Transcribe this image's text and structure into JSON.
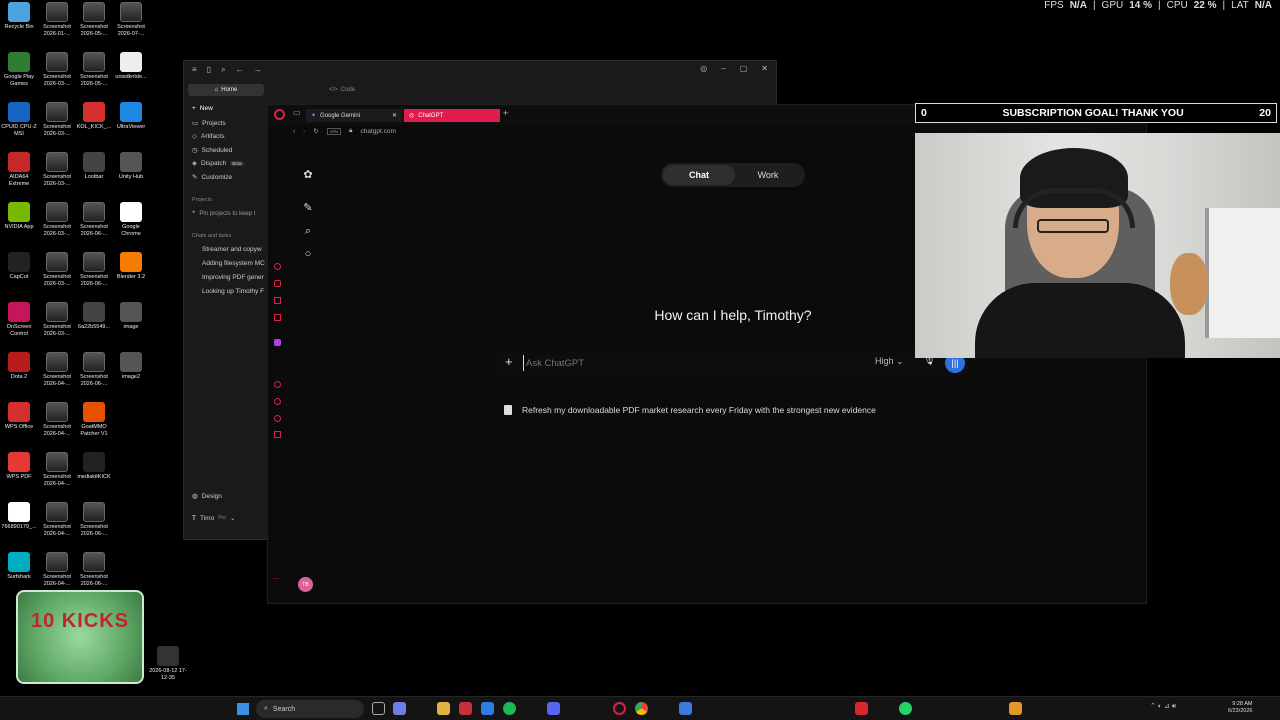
{
  "hud": {
    "fps_label": "FPS",
    "fps_value": "N/A",
    "gpu_label": "GPU",
    "gpu_value": "14 %",
    "cpu_label": "CPU",
    "cpu_value": "22 %",
    "lat_label": "LAT",
    "lat_value": "N/A"
  },
  "desktop_icons": [
    {
      "label": "Recycle Bin"
    },
    {
      "label": "Screenshot 2026-01-..."
    },
    {
      "label": "Screenshot 2026-05-..."
    },
    {
      "label": "Screenshot 2026-07-..."
    },
    {
      "label": "Google Play Games"
    },
    {
      "label": "Screenshot 2026-03-..."
    },
    {
      "label": "Screenshot 2026-05-..."
    },
    {
      "label": "unisdkntde..."
    },
    {
      "label": "CPUID CPU-Z MSI"
    },
    {
      "label": "Screenshot 2026-03-..."
    },
    {
      "label": "KOL_KICK_..."
    },
    {
      "label": "UltraViewer"
    },
    {
      "label": "AIDA64 Extreme"
    },
    {
      "label": "Screenshot 2026-03-..."
    },
    {
      "label": "Lootbar"
    },
    {
      "label": "Unity Hub"
    },
    {
      "label": "NVIDIA App"
    },
    {
      "label": "Screenshot 2026-03-..."
    },
    {
      "label": "Screenshot 2026-06-..."
    },
    {
      "label": "Google Chrome"
    },
    {
      "label": "CapCut"
    },
    {
      "label": "Screenshot 2026-03-..."
    },
    {
      "label": "Screenshot 2026-06-..."
    },
    {
      "label": "Blender 3.2"
    },
    {
      "label": "OnScreen Control"
    },
    {
      "label": "Screenshot 2026-03-..."
    },
    {
      "label": "6a22b5549..."
    },
    {
      "label": "image"
    },
    {
      "label": "Dota 2"
    },
    {
      "label": "Screenshot 2026-04-..."
    },
    {
      "label": "Screenshot 2026-06-..."
    },
    {
      "label": "image2"
    },
    {
      "label": "WPS Office"
    },
    {
      "label": "Screenshot 2026-04-..."
    },
    {
      "label": "GoatMMO Patcher V1"
    },
    {
      "label": "WPS PDF"
    },
    {
      "label": "Screenshot 2026-04-..."
    },
    {
      "label": "mediakitKICK"
    },
    {
      "label": "766890179_..."
    },
    {
      "label": "Screenshot 2026-04-..."
    },
    {
      "label": "Screenshot 2026-06-..."
    },
    {
      "label": "Surfshark"
    },
    {
      "label": "Screenshot 2026-04-..."
    },
    {
      "label": "Screenshot 2026-06-..."
    },
    {
      "label": "2026-08-12 17-12-35"
    }
  ],
  "claude_app": {
    "tab_home": "Home",
    "tab_code": "Code",
    "nav": [
      {
        "label": "New"
      },
      {
        "label": "Projects"
      },
      {
        "label": "Artifacts"
      },
      {
        "label": "Scheduled"
      },
      {
        "label": "Dispatch",
        "badge": "Beta"
      },
      {
        "label": "Customize"
      }
    ],
    "projects_heading": "Projects",
    "projects_hint": "Pin projects to keep t",
    "chats_heading": "Chats and tasks",
    "chats": [
      "Streamer and copyw",
      "Adding filesystem MC",
      "Improving PDF gener",
      "Looking up Timothy F"
    ],
    "design": "Design",
    "user": "Timo",
    "plan": "Pro"
  },
  "browser": {
    "tabs": [
      {
        "label": "Google Gemini"
      },
      {
        "label": "ChatGPT"
      }
    ],
    "url": "chatgpt.com"
  },
  "chatgpt": {
    "mode_chat": "Chat",
    "mode_work": "Work",
    "greeting": "How can I help, Timothy?",
    "input_placeholder": "Ask ChatGPT",
    "model_level": "High",
    "suggestion": "Refresh my downloadable PDF market research every Friday with the strongest new evidence",
    "avatar_initials": "TB"
  },
  "overlay": {
    "goal_left": "0",
    "goal_text": "SUBSCRIPTION GOAL! THANK YOU",
    "goal_right": "20",
    "kicks_text": "10 KICKS"
  },
  "taskbar": {
    "search_label": "Search",
    "time": "9:28 AM",
    "date": "6/23/2026"
  },
  "colors": {
    "accent_red": "#d9224b",
    "chatgpt_tab": "#e01e4d",
    "voice_blue": "#2f6fe0"
  }
}
